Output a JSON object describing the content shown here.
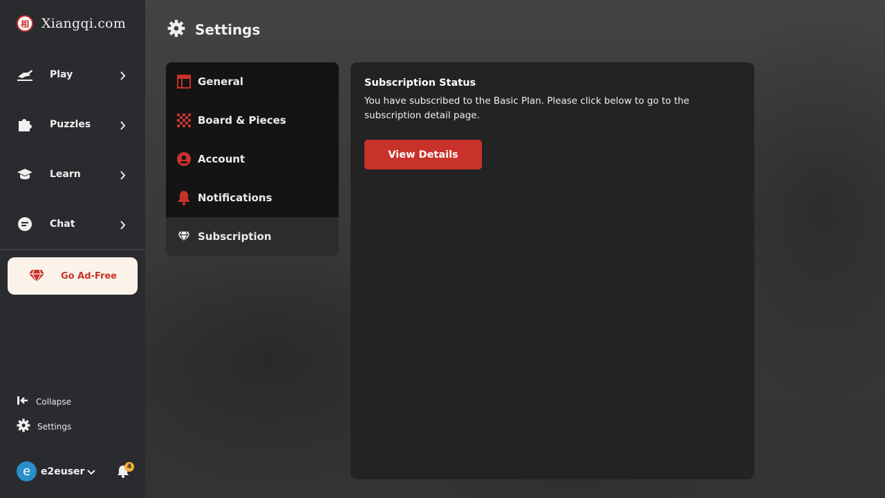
{
  "brand": {
    "name": "Xiangqi.com",
    "badge": "相"
  },
  "sidebar": {
    "nav": [
      {
        "label": "Play"
      },
      {
        "label": "Puzzles"
      },
      {
        "label": "Learn"
      },
      {
        "label": "Chat"
      }
    ],
    "ad_free_label": "Go Ad-Free",
    "collapse_label": "Collapse",
    "settings_label": "Settings",
    "user": {
      "initial": "e",
      "name": "e2euser"
    },
    "notifications_count": "4"
  },
  "header": {
    "title": "Settings"
  },
  "settings_menu": {
    "items": [
      {
        "label": "General"
      },
      {
        "label": "Board & Pieces"
      },
      {
        "label": "Account"
      },
      {
        "label": "Notifications"
      },
      {
        "label": "Subscription"
      }
    ],
    "active": "Subscription"
  },
  "panel": {
    "title": "Subscription Status",
    "text": "You have subscribed to the Basic Plan. Please click below to go to the subscription detail page.",
    "button_label": "View Details"
  },
  "colors": {
    "accent": "#c8322b",
    "sidebar_bg": "#2a2b2e",
    "panel_bg": "#232323",
    "badge": "#f2b233"
  }
}
